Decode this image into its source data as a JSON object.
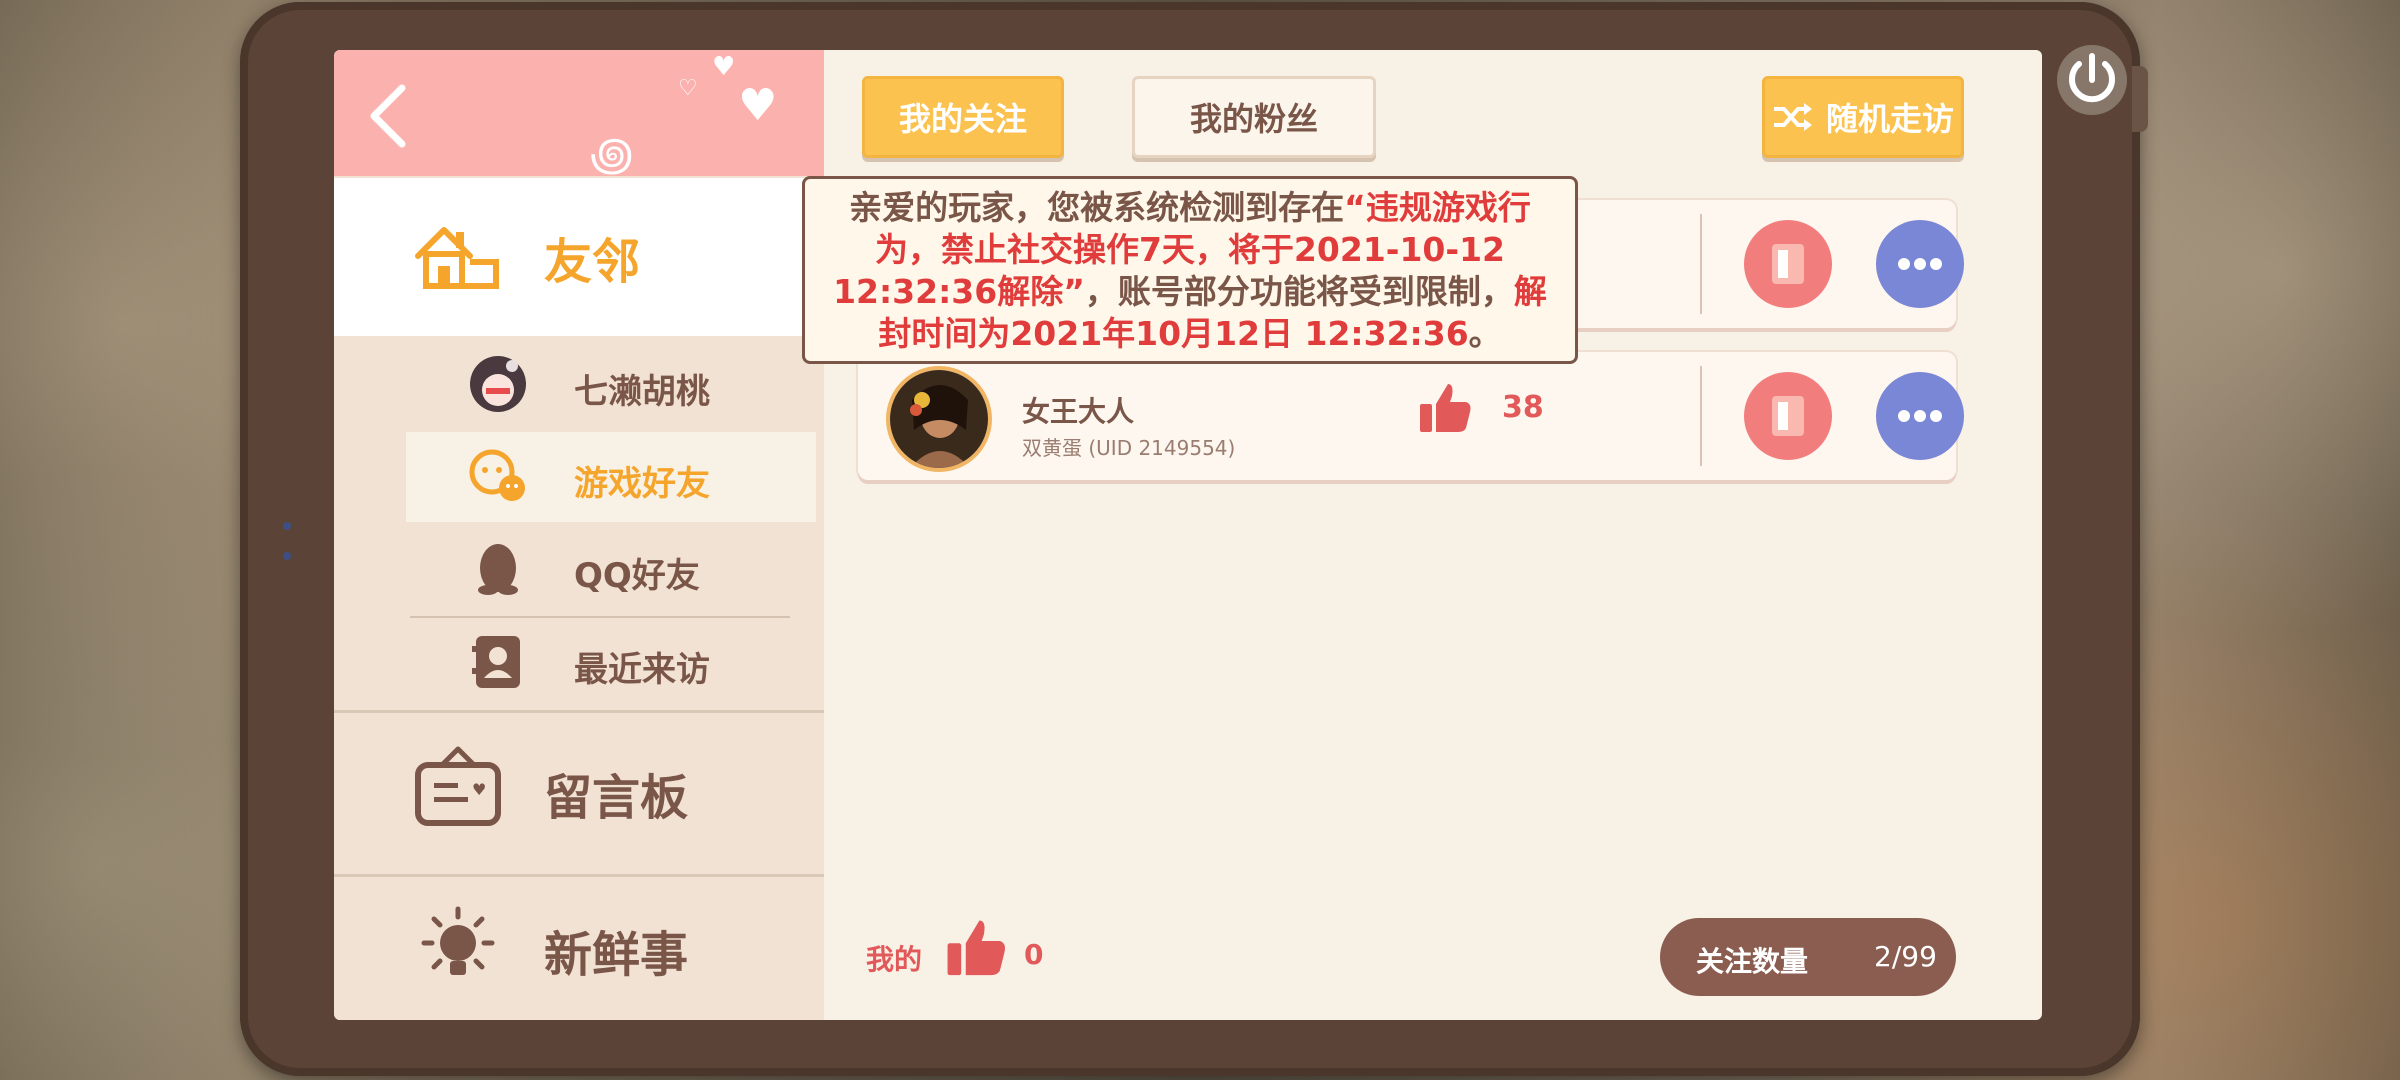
{
  "header": {
    "tab_following": "我的关注",
    "tab_fans": "我的粉丝",
    "random_visit": "随机走访"
  },
  "sidebar": {
    "friends_label": "友邻",
    "sub_items": [
      {
        "label": "七濑胡桃"
      },
      {
        "label": "游戏好友"
      },
      {
        "label": "QQ好友"
      },
      {
        "label": "最近来访"
      }
    ],
    "board_label": "留言板",
    "news_label": "新鲜事"
  },
  "notice": {
    "part1": "亲爱的玩家，您被系统检测到存在",
    "part2": "“违规游戏行为，禁止社交操作7天，将于2021-10-12 12:32:36解除”",
    "part3": "，账号部分功能将受到限制，",
    "part4": "解封时间为2021年10月12日 12:32:36",
    "part5": "。"
  },
  "friends": [
    {
      "name": "女王大人",
      "uid": "双黄蛋  (UID 2149554)",
      "likes": "38"
    }
  ],
  "footer": {
    "my_label": "我的",
    "my_likes": "0",
    "follow_label": "关注数量",
    "follow_value": "2/99"
  },
  "colors": {
    "accent": "#fbc24f",
    "brown": "#7a5649",
    "red": "#e2595a",
    "pink_header": "#fbb1ad"
  }
}
